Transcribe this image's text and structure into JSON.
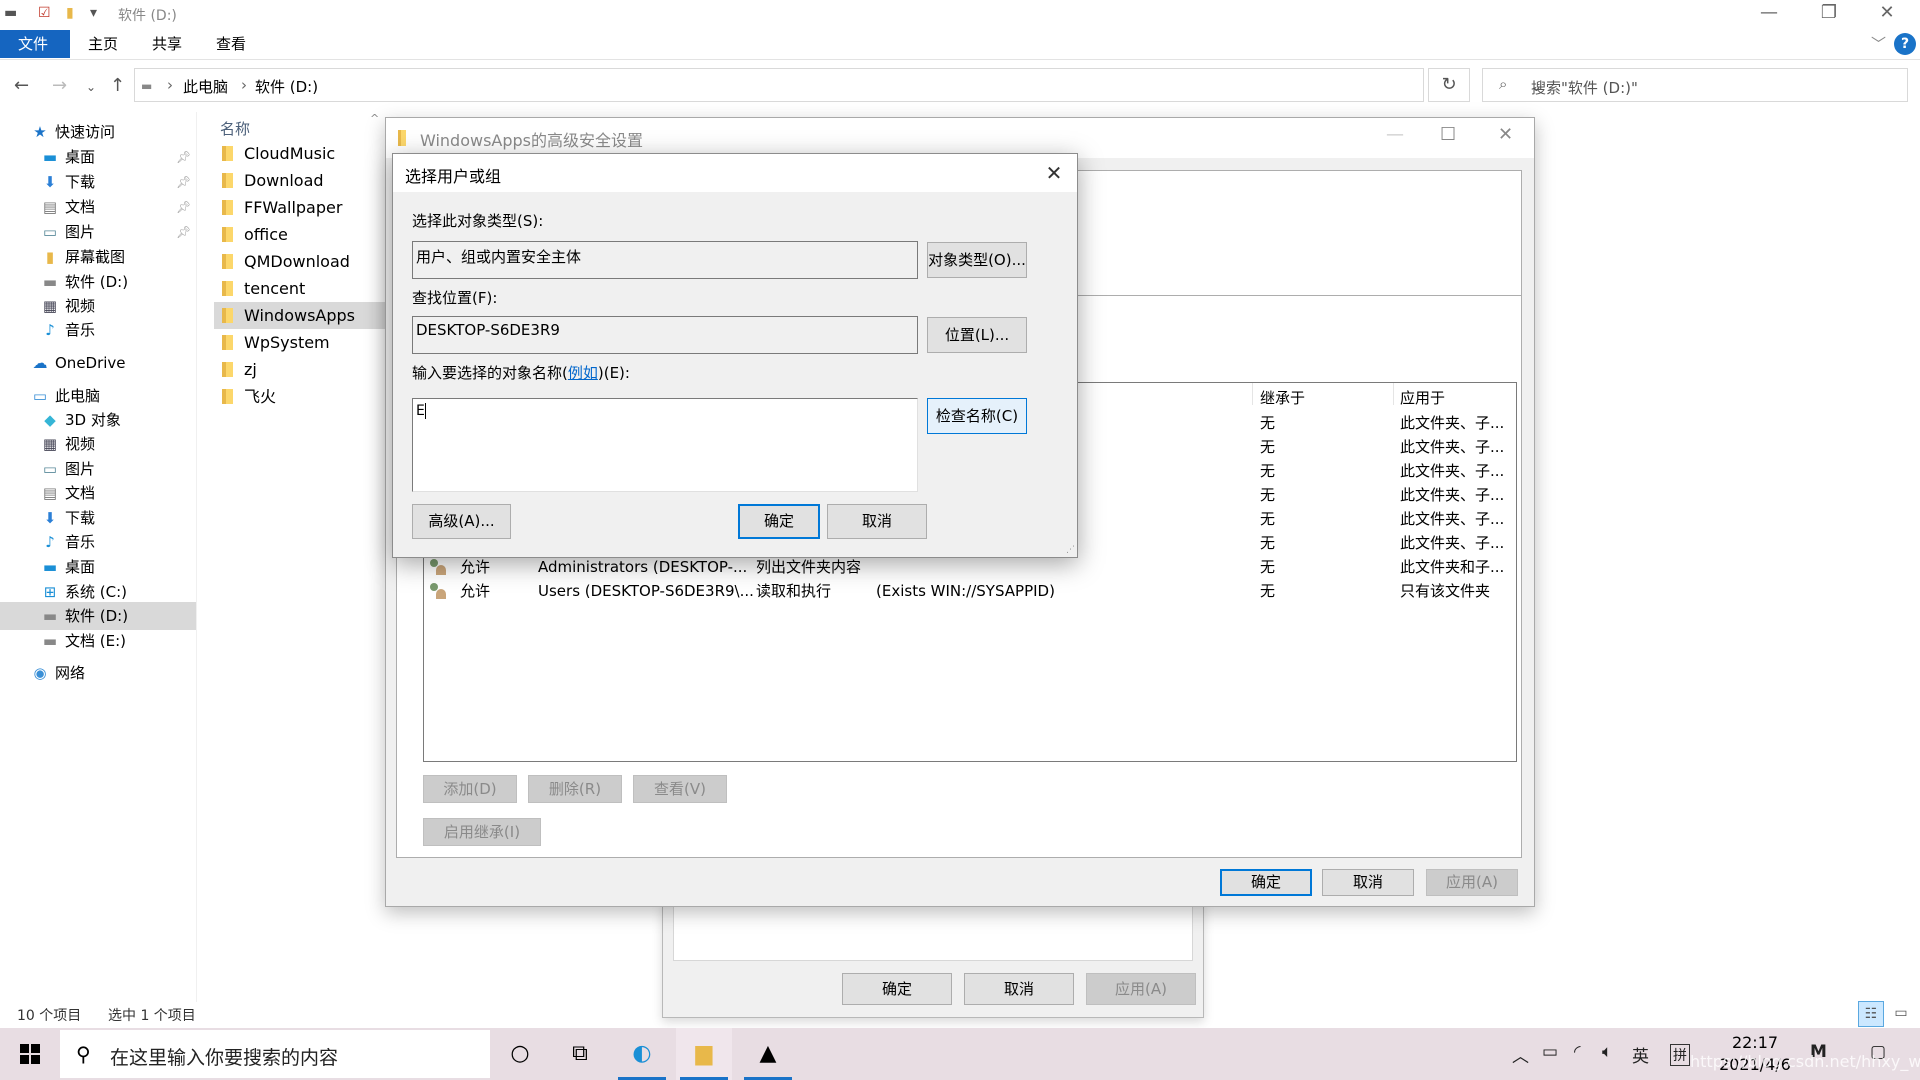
{
  "window": {
    "title": "软件 (D:)",
    "controls": {
      "minimize": "—",
      "restore": "❐",
      "close": "✕"
    }
  },
  "ribbon": {
    "tabs": [
      {
        "label": "文件",
        "active": true
      },
      {
        "label": "主页"
      },
      {
        "label": "共享"
      },
      {
        "label": "查看"
      }
    ],
    "help": "?"
  },
  "address": {
    "crumbs": [
      "此电脑",
      "软件 (D:)"
    ],
    "search_placeholder": "搜索\"软件 (D:)\""
  },
  "navpane": {
    "items": [
      {
        "label": "快速访问",
        "icon": "star-icon",
        "level": 0
      },
      {
        "label": "桌面",
        "icon": "desktop-icon",
        "level": 1,
        "pinned": true
      },
      {
        "label": "下载",
        "icon": "download-icon",
        "level": 1,
        "pinned": true
      },
      {
        "label": "文档",
        "icon": "document-icon",
        "level": 1,
        "pinned": true
      },
      {
        "label": "图片",
        "icon": "pictures-icon",
        "level": 1,
        "pinned": true
      },
      {
        "label": "屏幕截图",
        "icon": "folder-icon",
        "level": 1
      },
      {
        "label": "软件 (D:)",
        "icon": "drive-icon",
        "level": 1
      },
      {
        "label": "视频",
        "icon": "video-icon",
        "level": 1
      },
      {
        "label": "音乐",
        "icon": "music-icon",
        "level": 1
      },
      {
        "label": "OneDrive",
        "icon": "cloud-icon",
        "level": 0
      },
      {
        "label": "此电脑",
        "icon": "computer-icon",
        "level": 0
      },
      {
        "label": "3D 对象",
        "icon": "cube-icon",
        "level": 1
      },
      {
        "label": "视频",
        "icon": "video-icon",
        "level": 1
      },
      {
        "label": "图片",
        "icon": "pictures-icon",
        "level": 1
      },
      {
        "label": "文档",
        "icon": "document-icon",
        "level": 1
      },
      {
        "label": "下载",
        "icon": "download-icon",
        "level": 1
      },
      {
        "label": "音乐",
        "icon": "music-icon",
        "level": 1
      },
      {
        "label": "桌面",
        "icon": "desktop-icon",
        "level": 1
      },
      {
        "label": "系统 (C:)",
        "icon": "system-drive-icon",
        "level": 1
      },
      {
        "label": "软件 (D:)",
        "icon": "drive-icon",
        "level": 1,
        "selected": true
      },
      {
        "label": "文档 (E:)",
        "icon": "drive-icon",
        "level": 1
      },
      {
        "label": "网络",
        "icon": "network-icon",
        "level": 0
      }
    ]
  },
  "filelist": {
    "column_header": "名称",
    "items": [
      {
        "name": "CloudMusic"
      },
      {
        "name": "Download"
      },
      {
        "name": "FFWallpaper"
      },
      {
        "name": "office"
      },
      {
        "name": "QMDownload"
      },
      {
        "name": "tencent"
      },
      {
        "name": "WindowsApps",
        "selected": true
      },
      {
        "name": "WpSystem"
      },
      {
        "name": "zj"
      },
      {
        "name": "飞火"
      }
    ]
  },
  "status": {
    "count": "10 个项目",
    "selected": "选中 1 个项目"
  },
  "advanced": {
    "title": "WindowsApps的高级安全设置",
    "columns": {
      "inherited": "继承于",
      "applies": "应用于"
    },
    "rows": [
      {
        "type": "",
        "principal": "",
        "access": "",
        "condition": "",
        "inherited": "无",
        "applies": "此文件夹、子..."
      },
      {
        "type": "",
        "principal": "",
        "access": "",
        "condition": "",
        "inherited": "无",
        "applies": "此文件夹、子..."
      },
      {
        "type": "",
        "principal": "",
        "access": "",
        "condition": "",
        "inherited": "无",
        "applies": "此文件夹、子..."
      },
      {
        "type": "",
        "principal": "",
        "access": "",
        "condition": "",
        "inherited": "无",
        "applies": "此文件夹、子..."
      },
      {
        "type": "",
        "principal": "",
        "access": "",
        "condition": "",
        "inherited": "无",
        "applies": "此文件夹、子..."
      },
      {
        "type": "",
        "principal": "",
        "access": "",
        "condition": "",
        "inherited": "无",
        "applies": "此文件夹、子..."
      },
      {
        "type": "允许",
        "principal": "Administrators (DESKTOP-...",
        "access": "列出文件夹内容",
        "condition": "",
        "inherited": "无",
        "applies": "此文件夹和子..."
      },
      {
        "type": "允许",
        "principal": "Users (DESKTOP-S6DE3R9\\...",
        "access": "读取和执行",
        "condition": "(Exists WIN://SYSAPPID)",
        "inherited": "无",
        "applies": "只有该文件夹"
      }
    ],
    "buttons": {
      "add": "添加(D)",
      "remove": "删除(R)",
      "view": "查看(V)",
      "enable_inheritance": "启用继承(I)",
      "ok": "确定",
      "cancel": "取消",
      "apply": "应用(A)"
    }
  },
  "props_behind": {
    "ok": "确定",
    "cancel": "取消",
    "apply": "应用(A)"
  },
  "select_dialog": {
    "title": "选择用户或组",
    "object_type_label": "选择此对象类型(S):",
    "object_type_value": "用户、组或内置安全主体",
    "object_type_button": "对象类型(O)...",
    "location_label": "查找位置(F):",
    "location_value": "DESKTOP-S6DE3R9",
    "location_button": "位置(L)...",
    "names_label_prefix": "输入要选择的对象名称(",
    "names_label_link": "例如",
    "names_label_suffix": ")(E):",
    "names_value": "E",
    "check_names_button": "检查名称(C)",
    "advanced_button": "高级(A)...",
    "ok": "确定",
    "cancel": "取消"
  },
  "taskbar": {
    "search_placeholder": "在这里输入你要搜索的内容",
    "time": "22:17",
    "date": "2021/4/6",
    "ime_lang": "英",
    "ime_mode": "拼",
    "watermark": "https://blog.csdn.net/hhxy_wlzx"
  }
}
